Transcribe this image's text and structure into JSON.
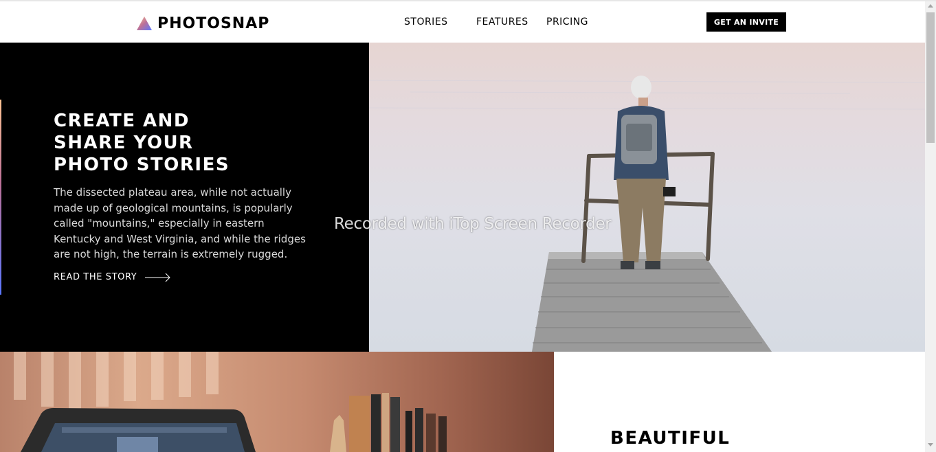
{
  "brand": {
    "name": "PHOTOSNAP",
    "icon": "triangle-logo-icon"
  },
  "nav": {
    "items": [
      "STORIES",
      "FEATURES",
      "PRICING"
    ]
  },
  "header": {
    "cta_label": "GET AN INVITE"
  },
  "hero": {
    "title_lines": [
      "CREATE AND",
      "SHARE YOUR",
      "PHOTO STORIES"
    ],
    "body": "The dissected plateau area, while not actually made up of geological mountains, is popularly called \"mountains,\" especially in eastern Kentucky and West Virginia, and while the ridges are not high, the terrain is extremely rugged.",
    "link_label": "READ THE STORY",
    "link_icon": "arrow-right-icon"
  },
  "overlay": {
    "watermark": "Recorded with iTop Screen Recorder"
  },
  "section2": {
    "title": "BEAUTIFUL"
  },
  "colors": {
    "accent_gradient": [
      "#ffc593",
      "#bc7198",
      "#5a77ff"
    ],
    "dark": "#000000",
    "light": "#ffffff"
  }
}
